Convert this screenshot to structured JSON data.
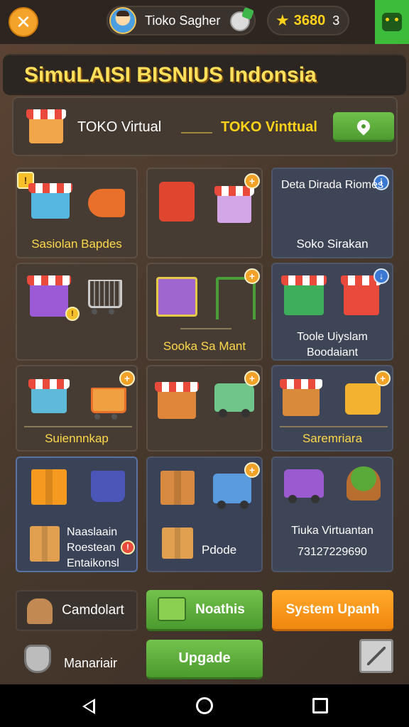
{
  "topbar": {
    "profile_name": "Tioko Sagher",
    "coins": "3680",
    "coin_count": "3",
    "icons": [
      "close-icon",
      "avatar",
      "star-icon",
      "robot-icon"
    ]
  },
  "title": "SimuLAISI BISNIUS Indonsia",
  "store_row": {
    "label_left": "TOKO Virtual",
    "label_right": "TOKO Vinttual"
  },
  "cards": [
    {
      "label": "Sasiolan Bapdes"
    },
    {
      "label": ""
    },
    {
      "label": "Soko Sirakan",
      "title": "Deta Dirada Riomes"
    },
    {
      "label": ""
    },
    {
      "label": "Sooka Sa Mant"
    },
    {
      "label": "Toole Uiyslam Boodaiant"
    },
    {
      "label": "Suiennnkap"
    },
    {
      "label": ""
    },
    {
      "label": "Saremriara"
    },
    {
      "label": "Naaslaain Roestean Entaikonsl"
    },
    {
      "label": "Pdode"
    },
    {
      "label": "Tiuka Virtuantan",
      "value": "73127229690"
    }
  ],
  "bottom": {
    "btn_left": "Camdolart",
    "btn_mid": "Noathis",
    "btn_right": "System Upanh",
    "manage_label": "Manariair",
    "upgrade": "Upgade"
  },
  "colors": {
    "accent_green": "#4e9c30",
    "accent_orange": "#f0860f",
    "title_yellow": "#ffe05b"
  }
}
